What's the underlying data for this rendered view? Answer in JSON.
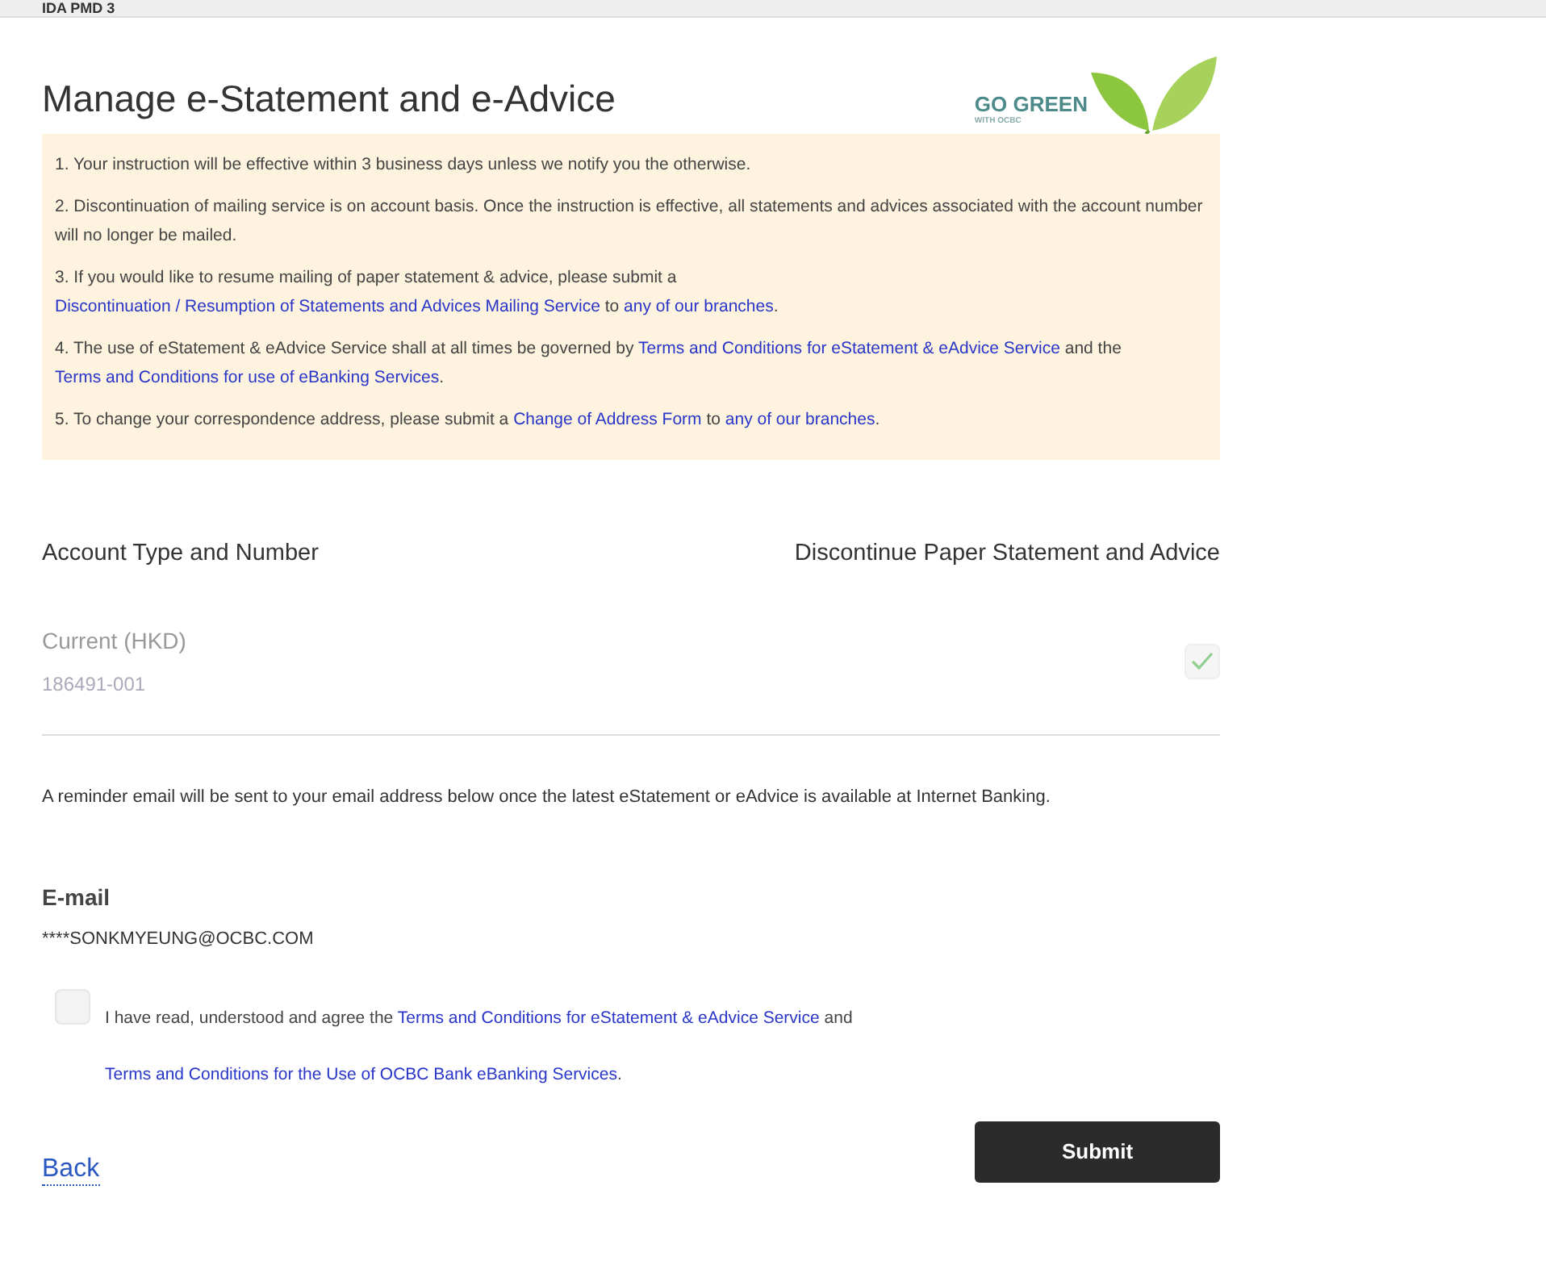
{
  "header_label": "IDA PMD 3",
  "title": "Manage e-Statement and e-Advice",
  "logo": {
    "line_1": "GO GREEN",
    "line_2": "WITH OCBC"
  },
  "notes": [
    {
      "parts": [
        {
          "text": "1. Your instruction will be effective within 3 business days unless we notify you the otherwise.",
          "link": false
        }
      ]
    },
    {
      "parts": [
        {
          "text": "2. Discontinuation of mailing service is on account basis. Once the instruction is effective, all statements and advices associated with the account number will no longer be mailed.",
          "link": false
        }
      ]
    },
    {
      "parts": [
        {
          "text": "3. If you would like to resume mailing of paper statement & advice, please submit a ",
          "link": false
        },
        {
          "text": "Discontinuation / Resumption of Statements and Advices Mailing Service",
          "link": true
        },
        {
          "text": " to ",
          "link": false
        },
        {
          "text": "any of our branches",
          "link": true
        },
        {
          "text": ".",
          "link": false
        }
      ]
    },
    {
      "parts": [
        {
          "text": "4. The use of eStatement & eAdvice Service shall at all times be governed by ",
          "link": false
        },
        {
          "text": "Terms and Conditions for eStatement & eAdvice Service",
          "link": true
        },
        {
          "text": " and the ",
          "link": false
        },
        {
          "text": "Terms and Conditions for use of eBanking Services",
          "link": true
        },
        {
          "text": ".",
          "link": false
        }
      ]
    },
    {
      "parts": [
        {
          "text": "5. To change your correspondence address, please submit a ",
          "link": false
        },
        {
          "text": "Change of Address Form",
          "link": true
        },
        {
          "text": " to ",
          "link": false
        },
        {
          "text": "any of our branches",
          "link": true
        },
        {
          "text": ".",
          "link": false
        }
      ]
    }
  ],
  "table": {
    "columns": [
      "Account Type and Number",
      "Discontinue Paper Statement and Advice"
    ],
    "rows": [
      {
        "type": "Current (HKD)",
        "number": "186491-001",
        "checked": true,
        "disabled": true
      }
    ]
  },
  "reminder": "A reminder email will be sent to your email address below once the latest eStatement or eAdvice is available at Internet Banking.",
  "email": {
    "label": "E-mail",
    "value": "****SONKMYEUNG@OCBC.COM"
  },
  "agreement": {
    "checked": false,
    "parts": [
      {
        "text": "I have read, understood and agree the ",
        "link": false
      },
      {
        "text": "Terms and Conditions for eStatement & eAdvice Service",
        "link": true
      },
      {
        "text": " and ",
        "link": false
      },
      {
        "text": "Terms and Conditions for the Use of OCBC Bank eBanking Services",
        "link": true
      },
      {
        "text": ".",
        "link": false
      }
    ]
  },
  "buttons": {
    "back": "Back",
    "submit": "Submit"
  }
}
